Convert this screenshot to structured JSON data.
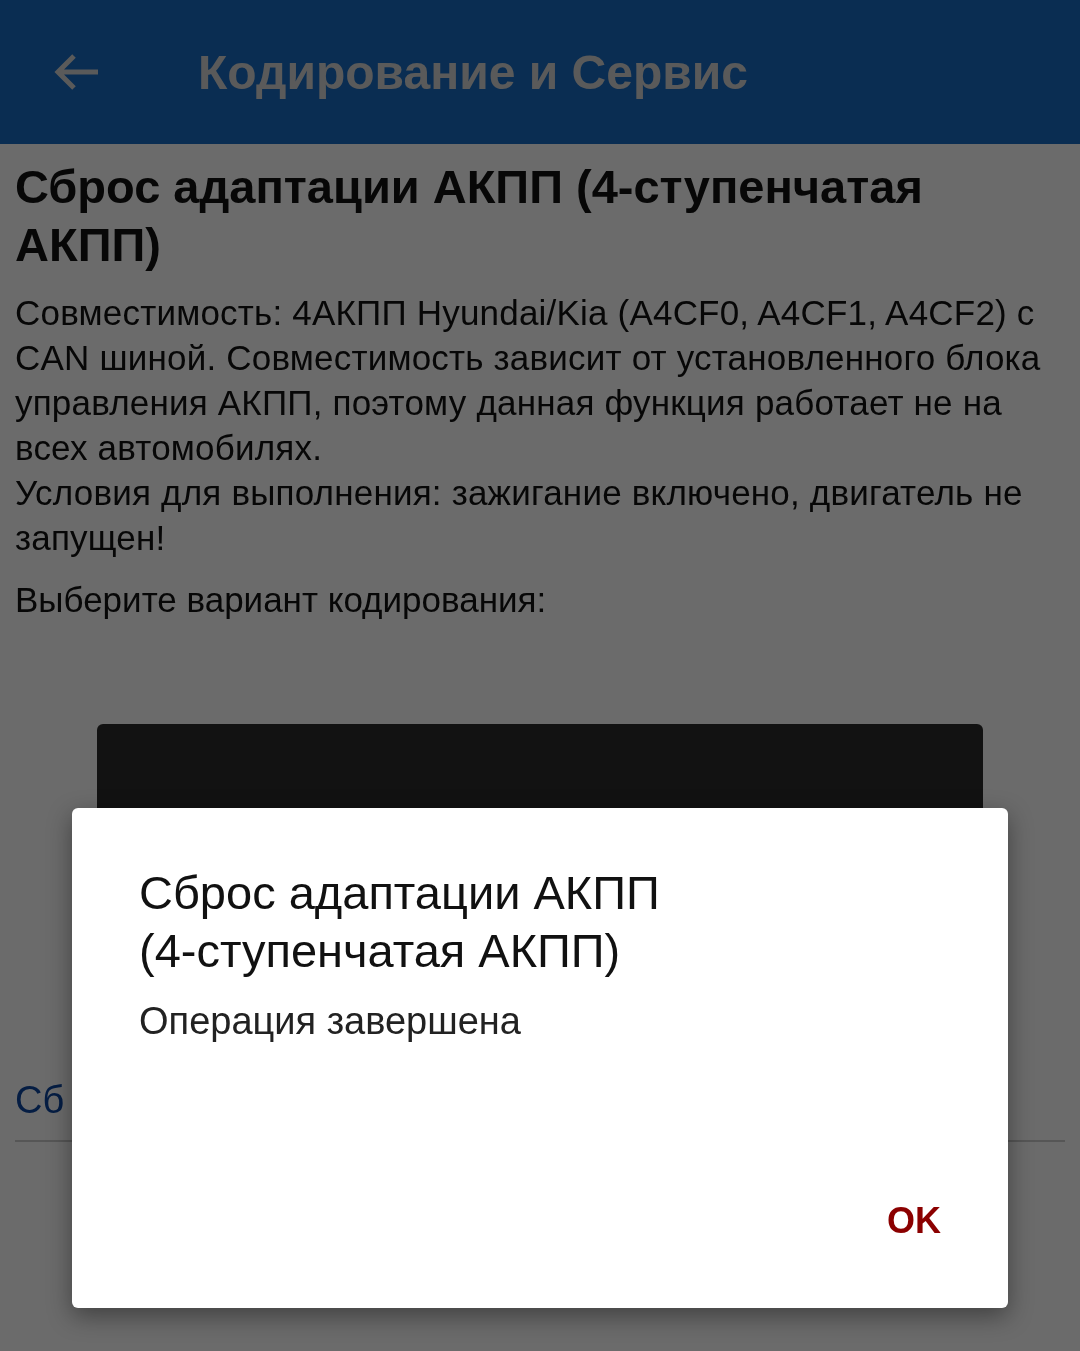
{
  "app_bar": {
    "title": "Кодирование и Сервис"
  },
  "page": {
    "title": "Сброс адаптации АКПП (4-ступенчатая АКПП)",
    "description": [
      "Совместимость: 4АКПП Hyundai/Kia (A4CF0, A4CF1, A4CF2) с CAN шиной. Совместимость зависит от установленного блока управления АКПП, поэтому данная функция работает не на всех автомобилях.",
      "Условия для выполнения: зажигание включено, двигатель не запущен!"
    ],
    "prompt": "Выберите вариант кодирования:",
    "link": "Сб"
  },
  "dialog": {
    "title": "Сброс адаптации АКПП (4-ступенчатая АКПП)",
    "message": "Операция завершена",
    "buttons": [
      "OK"
    ]
  }
}
